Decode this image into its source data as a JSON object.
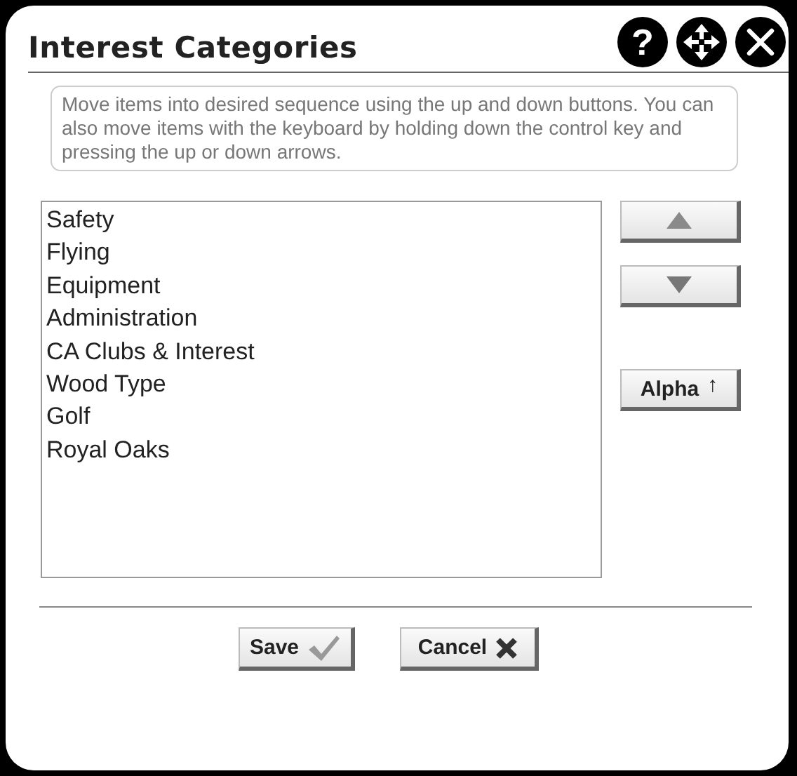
{
  "dialog": {
    "title": "Interest Categories",
    "help_label": "?"
  },
  "instructions": "Move items into desired sequence using the up and down buttons. You can also move items with the keyboard by holding down the control key and pressing the up or down arrows.",
  "list_items": [
    {
      "label": "Safety"
    },
    {
      "label": "Flying"
    },
    {
      "label": "Equipment"
    },
    {
      "label": "Administration"
    },
    {
      "label": "CA Clubs & Interest"
    },
    {
      "label": "Wood Type"
    },
    {
      "label": "Golf"
    },
    {
      "label": "Royal Oaks"
    }
  ],
  "side_buttons": [
    {
      "kind": "up"
    },
    {
      "kind": "down"
    },
    {
      "kind": "sort",
      "label": "Alpha",
      "arrow": "↑"
    }
  ],
  "footer_buttons": [
    {
      "kind": "save",
      "label": "Save"
    },
    {
      "kind": "cancel",
      "label": "Cancel"
    }
  ]
}
